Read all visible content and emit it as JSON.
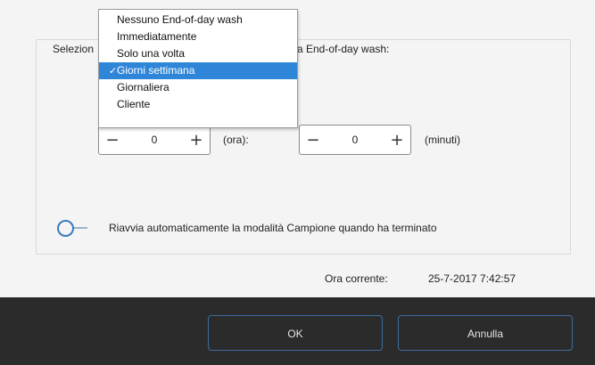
{
  "group": {
    "label_left": "Selezion",
    "label_right": "a End-of-day wash:"
  },
  "dropdown": {
    "items": [
      {
        "label": "Nessuno End-of-day wash"
      },
      {
        "label": "Immediatamente"
      },
      {
        "label": "Solo una volta"
      },
      {
        "label": "Giorni settimana",
        "selected": true
      },
      {
        "label": "Giornaliera"
      },
      {
        "label": "Cliente"
      }
    ],
    "check_glyph": "✓"
  },
  "hours": {
    "value": "0",
    "minus": "−",
    "plus": "+",
    "unit": "(ora):"
  },
  "minutes": {
    "value": "0",
    "minus": "−",
    "plus": "+",
    "unit": "(minuti)"
  },
  "auto_restart": {
    "label": "Riavvia automaticamente la modalità Campione quando ha terminato",
    "enabled": false
  },
  "clock": {
    "label": "Ora corrente:",
    "value": "25-7-2017 7:42:57"
  },
  "buttons": {
    "ok": "OK",
    "cancel": "Annulla"
  },
  "colors": {
    "selection": "#2f86d8",
    "footer_bg": "#2b2b2b",
    "button_border": "#3d6e9e",
    "toggle_accent": "#3b7bbd"
  }
}
